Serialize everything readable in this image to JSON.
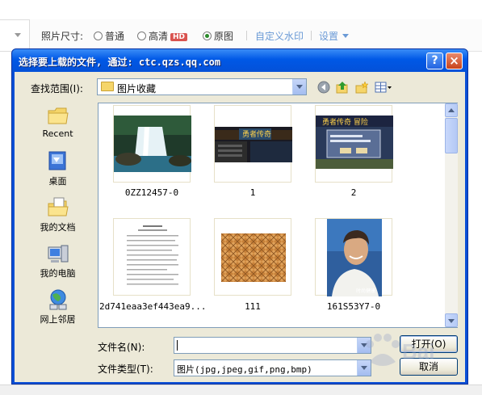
{
  "background_toolbar": {
    "photo_size_label": "照片尺寸:",
    "options": [
      {
        "label": "普通",
        "selected": false
      },
      {
        "label": "高清",
        "selected": false,
        "badge": "HD"
      },
      {
        "label": "原图",
        "selected": true
      }
    ],
    "watermark_link": "自定义水印",
    "settings_link": "设置"
  },
  "dialog": {
    "title": "选择要上载的文件, 通过: ctc.qzs.qq.com",
    "help_label": "?",
    "close_label": "×",
    "look_in_label": "查找范围(I):",
    "look_in_value": "图片收藏",
    "places": [
      {
        "label": "Recent",
        "icon": "recent-folder-icon"
      },
      {
        "label": "桌面",
        "icon": "desktop-icon"
      },
      {
        "label": "我的文档",
        "icon": "my-documents-icon"
      },
      {
        "label": "我的电脑",
        "icon": "my-computer-icon"
      },
      {
        "label": "网上邻居",
        "icon": "network-places-icon"
      }
    ],
    "files": [
      {
        "name": "0ZZ12457-0",
        "thumb": "waterfall"
      },
      {
        "name": "1",
        "thumb": "game-screenshot"
      },
      {
        "name": "2",
        "thumb": "game-dialog-screenshot"
      },
      {
        "name": "2d741eaa3ef443ea9...",
        "thumb": "text-document"
      },
      {
        "name": "111",
        "thumb": "woven-texture"
      },
      {
        "name": "161S53Y7-0",
        "thumb": "portrait"
      }
    ],
    "filename_label": "文件名(N):",
    "filename_value": "",
    "filetype_label": "文件类型(T):",
    "filetype_value": "图片(jpg,jpeg,gif,png,bmp)",
    "open_button": "打开(O)",
    "cancel_button": "取消"
  },
  "colors": {
    "title_bar": "#0058e6",
    "dialog_face": "#ece9d8",
    "link_blue": "#6a9ad6",
    "selected_radio": "#2a8a2a"
  }
}
